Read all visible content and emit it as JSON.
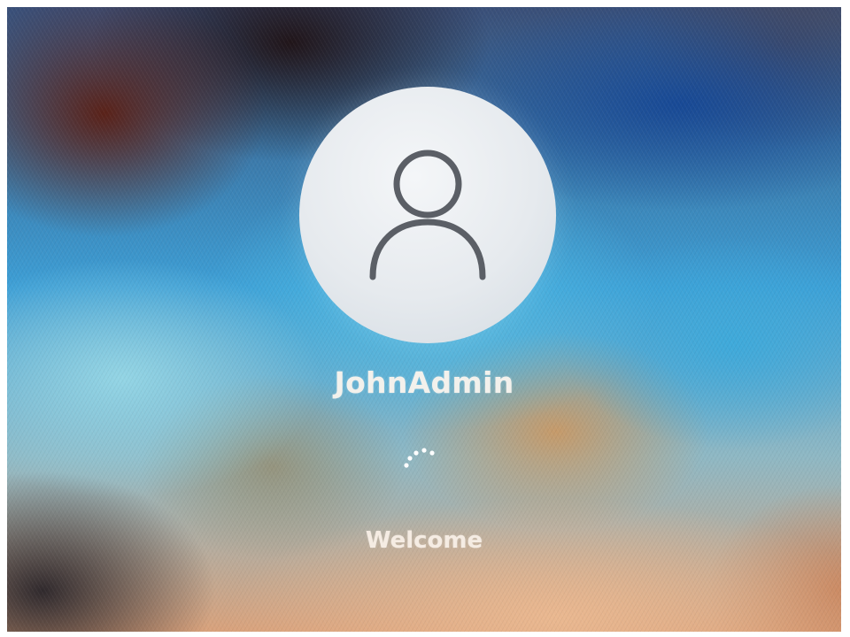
{
  "login_screen": {
    "username": "JohnAdmin",
    "status": "Welcome",
    "avatar_icon": "user-silhouette-icon",
    "spinner_icon": "loading-spinner-icon"
  }
}
